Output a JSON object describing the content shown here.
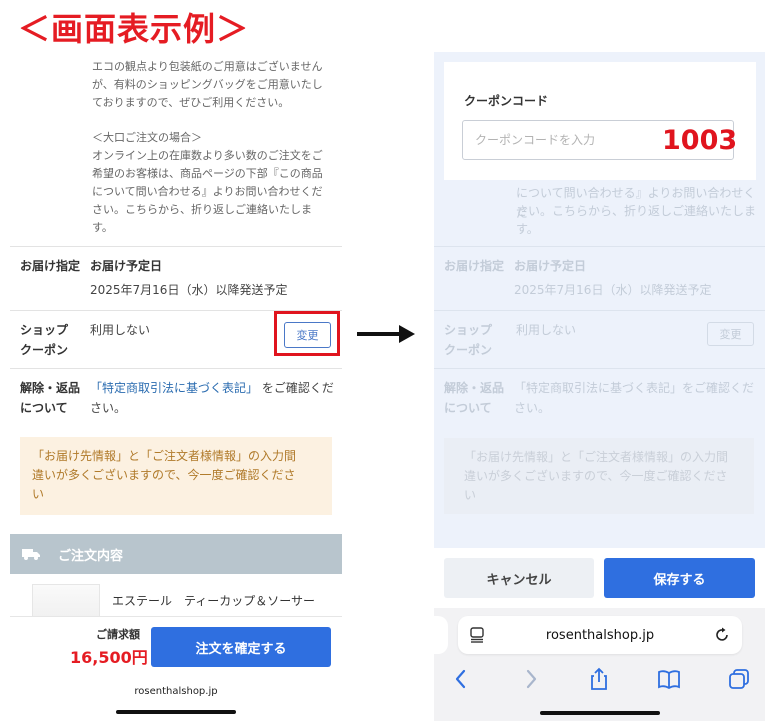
{
  "heading": "＜画面表示例＞",
  "left": {
    "intro_lines": [
      "エコの観点より包装紙のご用意はございません",
      "が、有料のショッピングバッグをご用意いたし",
      "ておりますので、ぜひご利用ください。",
      "＜大口ご注文の場合＞",
      "オンライン上の在庫数より多い数のご注文をご",
      "希望のお客様は、商品ページの下部『この商品",
      "について問い合わせる』よりお問い合わせくだ",
      "さい。こちらから、折り返しご連絡いたしま",
      "す。"
    ],
    "delivery_label": "お届け指定",
    "delivery_value": "お届け予定日",
    "delivery_date": "2025年7月16日（水）以降発送予定",
    "coupon_label_1": "ショップ",
    "coupon_label_2": "クーポン",
    "coupon_value": "利用しない",
    "change_button": "変更",
    "cancel_label_1": "解除・返品",
    "cancel_label_2": "について",
    "cancel_link": "「特定商取引法に基づく表記」",
    "cancel_text_1": "をご確認くだ",
    "cancel_text_2": "さい。",
    "warning_lines": [
      "「お届け先情報」と「ご注文者様情報」の入力間",
      "違いが多くございますので、今一度ご確認くださ",
      "い"
    ],
    "section_title": "ご注文内容",
    "product_name": "エステール　ティーカップ＆ソーサー",
    "bill_label": "ご請求額",
    "bill_amount": "16,500円",
    "confirm_button": "注文を確定する",
    "url": "rosenthalshop.jp"
  },
  "right": {
    "coupon_title": "クーポンコード",
    "coupon_placeholder": "クーポンコードを入力",
    "coupon_code": "1003",
    "cancel_button": "キャンセル",
    "save_button": "保存する",
    "url": "rosenthalshop.jp"
  },
  "colors": {
    "heading_red": "#e51c23",
    "primary_blue": "#2f6fe0",
    "highlight_red": "#e0141e"
  },
  "icons": [
    "truck-icon",
    "arrow-right-icon",
    "reader-icon",
    "reload-icon",
    "back-icon",
    "forward-icon",
    "share-icon",
    "bookmarks-icon",
    "tabs-icon"
  ]
}
